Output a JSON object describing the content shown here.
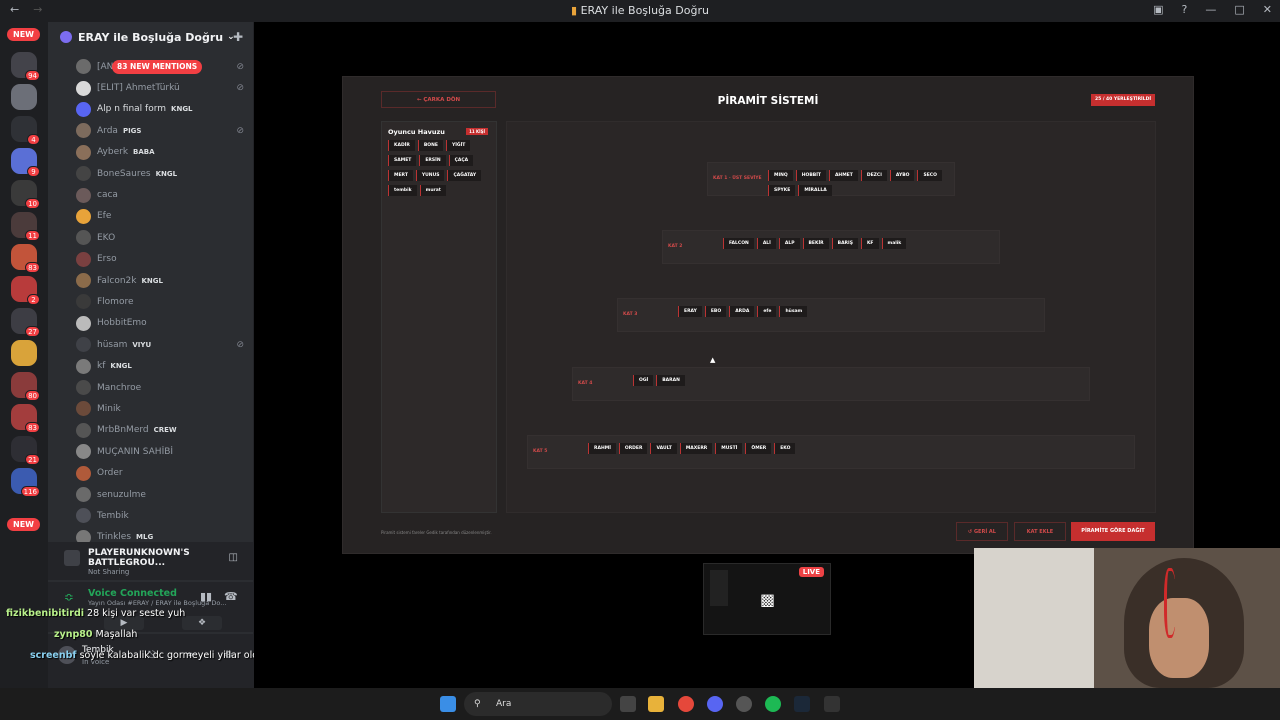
{
  "window": {
    "title": "ERAY ile Boşluğa Doğru",
    "nav_back": "←",
    "nav_forward": "→"
  },
  "guild_list": {
    "new_top": "NEW",
    "new_bottom": "NEW",
    "badges": [
      "94",
      "4",
      "9",
      "10",
      "11",
      "83",
      "2",
      "27",
      "80",
      "83",
      "21",
      "116"
    ]
  },
  "server": {
    "name": "ERAY ile Boşluğa Doğru",
    "new_mentions": "83 NEW MENTIONS"
  },
  "members": [
    {
      "name": "[AN",
      "tag": "",
      "color": "#949ba4"
    },
    {
      "name": "[ELIT] AhmetTürkü",
      "tag": "",
      "color": "#949ba4"
    },
    {
      "name": "Alp n final form",
      "tag": "KNGL",
      "color": "#dbdee1"
    },
    {
      "name": "Arda",
      "tag": "PIGS",
      "color": "#949ba4"
    },
    {
      "name": "Ayberk",
      "tag": "BABA",
      "color": "#949ba4"
    },
    {
      "name": "BoneSaures",
      "tag": "KNGL",
      "color": "#949ba4"
    },
    {
      "name": "caca",
      "tag": "",
      "color": "#949ba4"
    },
    {
      "name": "Efe",
      "tag": "",
      "color": "#949ba4"
    },
    {
      "name": "EKO",
      "tag": "",
      "color": "#949ba4"
    },
    {
      "name": "Erso",
      "tag": "",
      "color": "#949ba4"
    },
    {
      "name": "Falcon2k",
      "tag": "KNGL",
      "color": "#949ba4"
    },
    {
      "name": "Flomore",
      "tag": "",
      "color": "#949ba4"
    },
    {
      "name": "HobbitEmo",
      "tag": "",
      "color": "#949ba4"
    },
    {
      "name": "hüsam",
      "tag": "VIYU",
      "color": "#949ba4"
    },
    {
      "name": "kf",
      "tag": "KNGL",
      "color": "#949ba4"
    },
    {
      "name": "Manchroe",
      "tag": "",
      "color": "#949ba4"
    },
    {
      "name": "Minik",
      "tag": "",
      "color": "#949ba4"
    },
    {
      "name": "MrbBnMerd",
      "tag": "CREW",
      "color": "#949ba4"
    },
    {
      "name": "MUÇANIN SAHİBİ",
      "tag": "",
      "color": "#949ba4"
    },
    {
      "name": "Order",
      "tag": "",
      "color": "#949ba4"
    },
    {
      "name": "senuzulme",
      "tag": "",
      "color": "#949ba4"
    },
    {
      "name": "Tembik",
      "tag": "",
      "color": "#949ba4"
    },
    {
      "name": "Trinkles",
      "tag": "MLG",
      "color": "#949ba4"
    }
  ],
  "activity": {
    "game": "PLAYERUNKNOWN'S BATTLEGROU...",
    "status": "Not Sharing"
  },
  "voice": {
    "status": "Voice Connected",
    "channel": "Yayın Odası #ERAY / ERAY ile Boşluğa Do..."
  },
  "user": {
    "name": "Tembik",
    "status": "In voice"
  },
  "chat": [
    {
      "user": "fizikbenibitirdi",
      "text": "28 kişi var seste yuh"
    },
    {
      "user": "zynp80",
      "text": "Maşallah"
    },
    {
      "user": "screenbf",
      "text": "soyle kalabalik dc gormeyeli yillar oldu"
    }
  ],
  "app": {
    "back_label": "← ÇARKA DÖN",
    "title": "PİRAMİT SİSTEMİ",
    "placed": "25 / 40 YERLEŞTİRİLDİ",
    "pool_title": "Oyuncu Havuzu",
    "pool_count": "11 KİŞİ",
    "pool": [
      "KADİR",
      "BONE",
      "YİĞİT",
      "SAMET",
      "ERSİN",
      "ÇAÇA",
      "MERT",
      "YUNUS",
      "ÇAĞATAY",
      "tembik",
      "murat"
    ],
    "tiers": [
      {
        "label": "KAT 1 · ÜST SEVİYE",
        "players": [
          "MINQ",
          "HOBBİT",
          "AHMET",
          "DEZCI",
          "AYBO",
          "SECO",
          "SPYKE",
          "MİRALLA"
        ]
      },
      {
        "label": "KAT 2",
        "players": [
          "FALCON",
          "ALİ",
          "ALP",
          "BEKİR",
          "BARIŞ",
          "KF",
          "malik"
        ]
      },
      {
        "label": "KAT 3",
        "players": [
          "ERAY",
          "EBO",
          "ARDA",
          "efe",
          "hüsam"
        ]
      },
      {
        "label": "KAT 4",
        "players": [
          "OGİ",
          "BARAN"
        ]
      },
      {
        "label": "KAT 5",
        "players": [
          "RAHMİ",
          "ORDER",
          "VAULT",
          "MAXERR",
          "MUSTİ",
          "ÖMER",
          "EKO"
        ]
      }
    ],
    "footnote": "Piramit sistemi fareler Gedik tarafından düzenlenmiştir.",
    "undo": "GERİ AL",
    "add_tier": "KAT EKLE",
    "distribute": "PİRAMİTE GÖRE DAĞIT"
  },
  "stream_preview": {
    "live": "LIVE"
  },
  "taskbar": {
    "search": "Ara"
  }
}
